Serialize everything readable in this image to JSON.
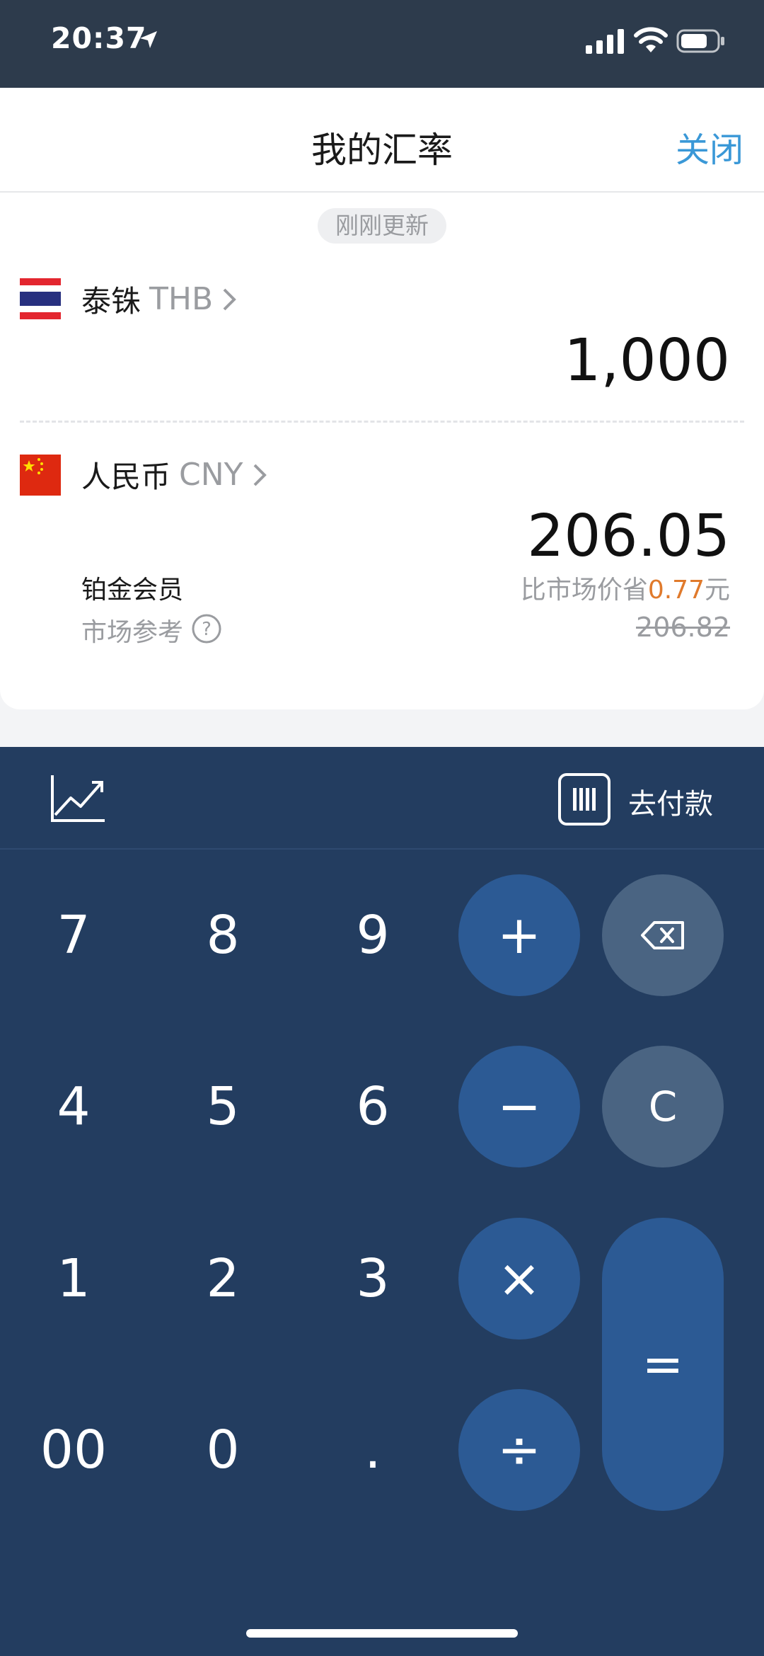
{
  "status_bar": {
    "time": "20:37"
  },
  "nav": {
    "title": "我的汇率",
    "close_label": "关闭"
  },
  "card": {
    "updated": "刚刚更新",
    "from_currency": {
      "name": "泰铢",
      "code": "THB",
      "amount": "1,000"
    },
    "to_currency": {
      "name": "人民币",
      "code": "CNY",
      "amount": "206.05"
    },
    "member_label": "铂金会员",
    "market_label": "市场参考",
    "save_prefix": "比市场价省",
    "save_amount": "0.77",
    "save_suffix": "元",
    "market_price": "206.82"
  },
  "keypad": {
    "pay_label": "去付款",
    "keys": {
      "k7": "7",
      "k8": "8",
      "k9": "9",
      "k4": "4",
      "k5": "5",
      "k6": "6",
      "k1": "1",
      "k2": "2",
      "k3": "3",
      "k00": "00",
      "k0": "0",
      "kdot": ".",
      "plus": "+",
      "minus": "−",
      "times": "×",
      "divide": "÷",
      "clear": "C",
      "equals": "="
    }
  },
  "colors": {
    "status_bg": "#2d3b4c",
    "accent_blue": "#3a98d7",
    "keypad_bg": "#233d60",
    "operator_key": "#2c5a94",
    "function_key": "#4a6482",
    "savings_orange": "#e07a2c"
  }
}
